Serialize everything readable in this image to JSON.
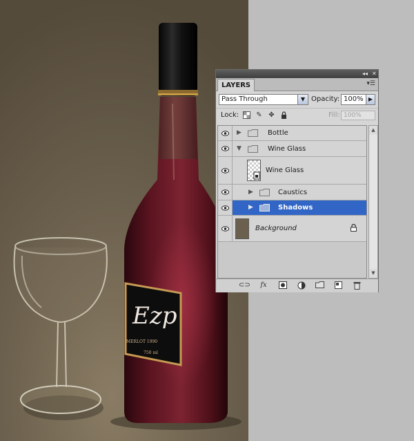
{
  "panel": {
    "tab_label": "LAYERS",
    "blend_mode": "Pass Through",
    "opacity_label": "Opacity:",
    "opacity_value": "100%",
    "lock_label": "Lock:",
    "fill_label": "Fill:",
    "fill_value": "100%"
  },
  "layers": [
    {
      "name": "Bottle",
      "type": "group",
      "expanded": false,
      "indent": 0
    },
    {
      "name": "Wine Glass",
      "type": "group",
      "expanded": true,
      "indent": 0
    },
    {
      "name": "Wine Glass",
      "type": "smart-object",
      "indent": 1
    },
    {
      "name": "Caustics",
      "type": "group",
      "expanded": false,
      "indent": 1
    },
    {
      "name": "Shadows",
      "type": "group",
      "expanded": false,
      "indent": 1,
      "selected": true
    },
    {
      "name": "Background",
      "type": "background",
      "locked": true
    }
  ],
  "colors": {
    "canvas_bg": "#6b604d",
    "wine": "#6e1a26",
    "selection": "#3166c6"
  },
  "label_text": {
    "script": "Ezp",
    "line": "MERLOT 1990",
    "volume": "750 ml"
  }
}
